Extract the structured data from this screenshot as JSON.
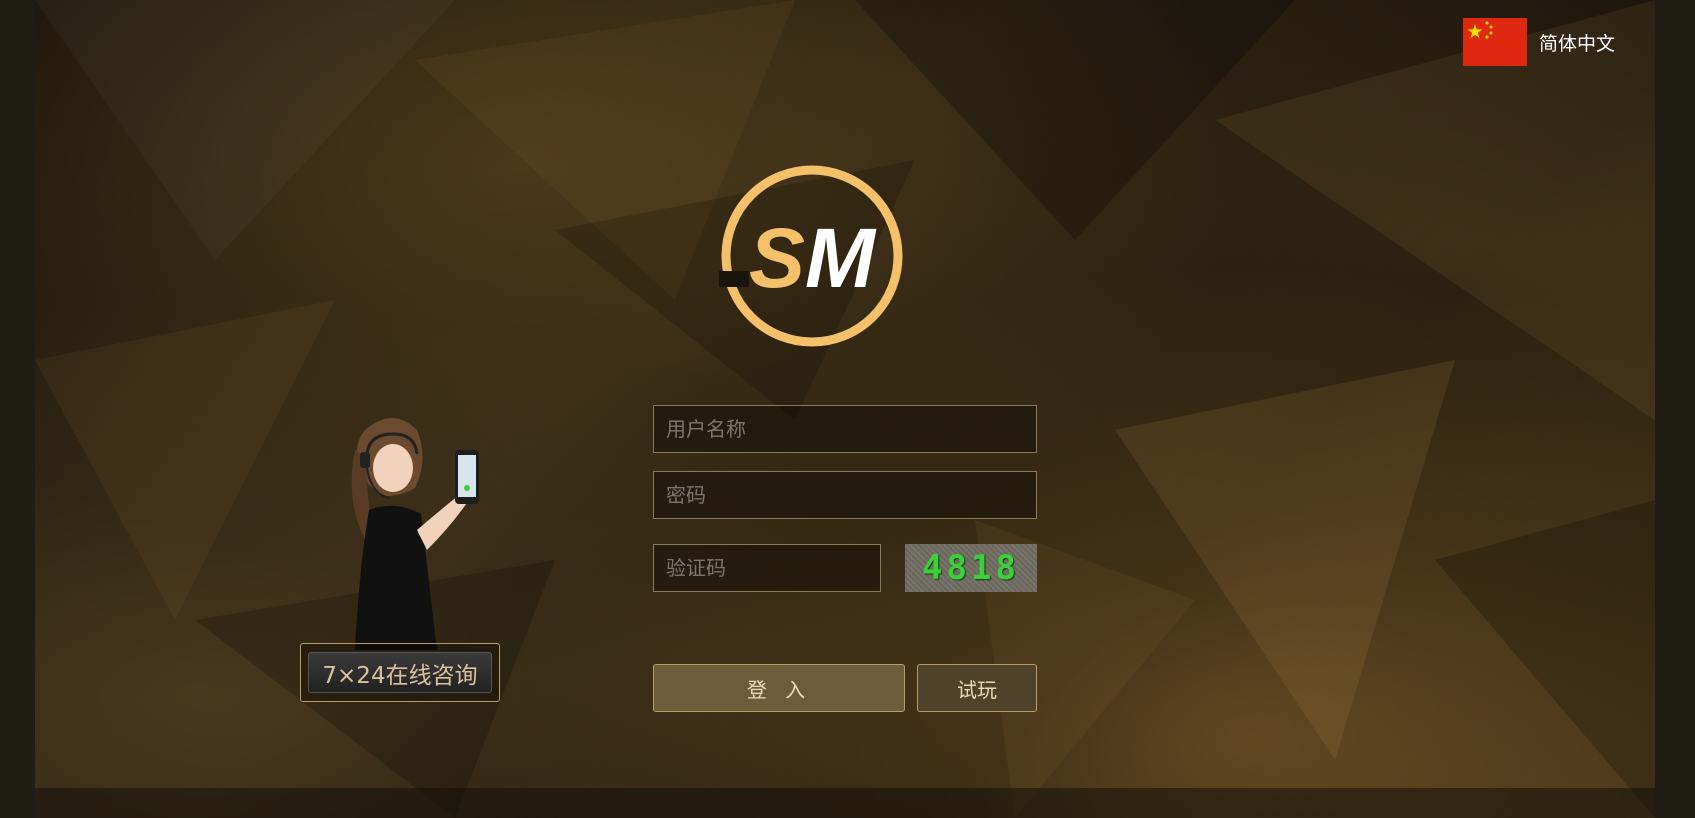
{
  "language": {
    "label": "简体中文",
    "flag_icon": "china-flag-icon"
  },
  "logo": {
    "text": "SM",
    "ring_color": "#f5c06a"
  },
  "form": {
    "username_placeholder": "用户名称",
    "password_placeholder": "密码",
    "captcha_placeholder": "验证码",
    "captcha_code": "4818",
    "login_label": "登 入",
    "trial_label": "试玩"
  },
  "support": {
    "label": "7×24在线咨询"
  },
  "colors": {
    "accent_gold": "#b89c6a",
    "login_bg": "#6d5c3a",
    "trial_bg": "#4f412a",
    "captcha_digits": "#3bd13b"
  }
}
